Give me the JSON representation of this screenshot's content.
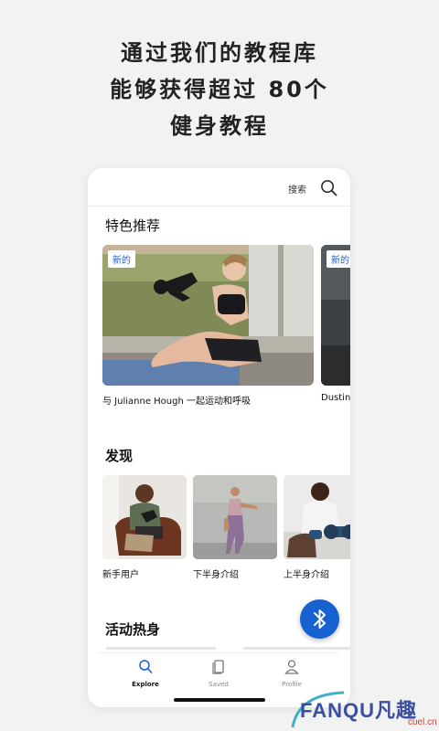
{
  "headline": {
    "line1": "通过我们的教程库",
    "line2": "能够获得超过 80个",
    "line3": "健身教程"
  },
  "topbar": {
    "search_label": "搜索"
  },
  "featured": {
    "title": "特色推荐",
    "cards": [
      {
        "badge": "新的",
        "caption": "与 Julianne Hough 一起运动和呼吸"
      },
      {
        "badge": "新的",
        "caption": "Dustin"
      }
    ]
  },
  "discover": {
    "title": "发现",
    "items": [
      {
        "label": "新手用户"
      },
      {
        "label": "下半身介绍"
      },
      {
        "label": "上半身介绍"
      }
    ]
  },
  "warmup": {
    "title": "活动热身"
  },
  "tabs": [
    {
      "label": "Explore",
      "icon": "search-icon",
      "active": true
    },
    {
      "label": "Saved",
      "icon": "bookmark-icon",
      "active": false
    },
    {
      "label": "Profile",
      "icon": "person-icon",
      "active": false
    }
  ],
  "watermark": {
    "text": "FANQU凡趣",
    "sub": "cuel.cn"
  },
  "colors": {
    "accent": "#1762d0",
    "badge_text": "#1b62c7"
  }
}
